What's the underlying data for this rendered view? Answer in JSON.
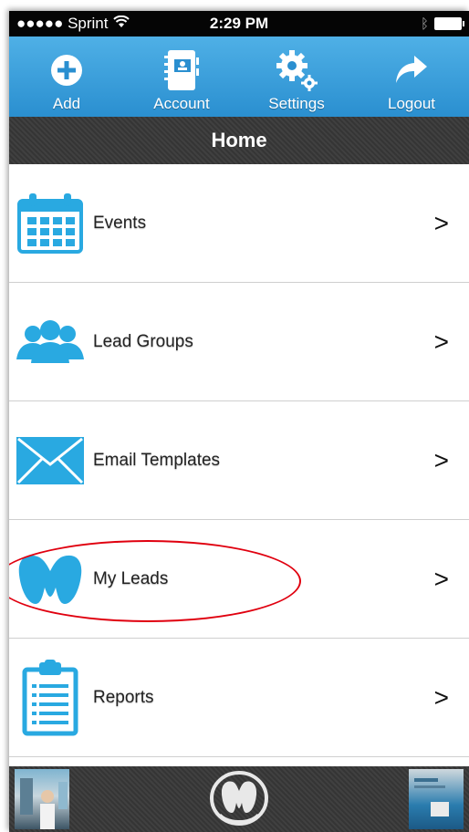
{
  "status_bar": {
    "carrier": "●●●●● Sprint",
    "time": "2:29 PM"
  },
  "toolbar": {
    "add_label": "Add",
    "account_label": "Account",
    "settings_label": "Settings",
    "logout_label": "Logout"
  },
  "header": {
    "title": "Home"
  },
  "menu": {
    "items": [
      {
        "label": "Events",
        "icon": "calendar-icon",
        "chevron": ">"
      },
      {
        "label": "Lead Groups",
        "icon": "people-group-icon",
        "chevron": ">"
      },
      {
        "label": "Email Templates",
        "icon": "envelope-icon",
        "chevron": ">"
      },
      {
        "label": "My Leads",
        "icon": "m-logo-icon",
        "chevron": ">"
      },
      {
        "label": "Reports",
        "icon": "clipboard-icon",
        "chevron": ">"
      }
    ]
  },
  "colors": {
    "accent_blue": "#2a8fd0",
    "icon_blue": "#29a9e1",
    "highlight_red": "#e0000f",
    "dark_bar": "#3a3a3a"
  }
}
